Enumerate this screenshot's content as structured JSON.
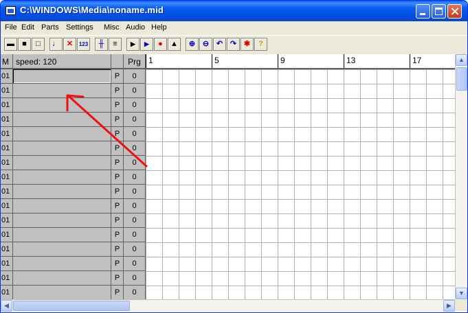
{
  "window": {
    "title": "C:\\WINDOWS\\Media\\noname.mid"
  },
  "menu": [
    "File",
    "Edit",
    "Parts",
    "Settings",
    "Misc",
    "Audio",
    "Help"
  ],
  "toolbar_icons": [
    "open-icon",
    "save-icon",
    "new-icon",
    "notes-icon",
    "cut-notes-icon",
    "number-icon",
    "grid-icon",
    "list-icon",
    "play-icon",
    "play-from-icon",
    "record-icon",
    "metronome-icon",
    "zoom-in-icon",
    "zoom-out-icon",
    "undo-icon",
    "redo-icon",
    "delete-icon",
    "help-icon"
  ],
  "header": {
    "m_label": "M",
    "speed_label": "speed: 120",
    "prg_label": "Prg"
  },
  "ruler": {
    "bars": [
      "1",
      "5",
      "9",
      "13",
      "17"
    ]
  },
  "rows": [
    {
      "num": "01",
      "p": "P",
      "prg": "0"
    },
    {
      "num": "01",
      "p": "P",
      "prg": "0"
    },
    {
      "num": "01",
      "p": "P",
      "prg": "0"
    },
    {
      "num": "01",
      "p": "P",
      "prg": "0"
    },
    {
      "num": "01",
      "p": "P",
      "prg": "0"
    },
    {
      "num": "01",
      "p": "P",
      "prg": "0"
    },
    {
      "num": "01",
      "p": "P",
      "prg": "0"
    },
    {
      "num": "01",
      "p": "P",
      "prg": "0"
    },
    {
      "num": "01",
      "p": "P",
      "prg": "0"
    },
    {
      "num": "01",
      "p": "P",
      "prg": "0"
    },
    {
      "num": "01",
      "p": "P",
      "prg": "0"
    },
    {
      "num": "01",
      "p": "P",
      "prg": "0"
    },
    {
      "num": "01",
      "p": "P",
      "prg": "0"
    },
    {
      "num": "01",
      "p": "P",
      "prg": "0"
    },
    {
      "num": "01",
      "p": "P",
      "prg": "0"
    },
    {
      "num": "01",
      "p": "P",
      "prg": "0"
    }
  ],
  "colors": {
    "title_blue": "#0050e6",
    "annotation_red": "#ee1111"
  }
}
